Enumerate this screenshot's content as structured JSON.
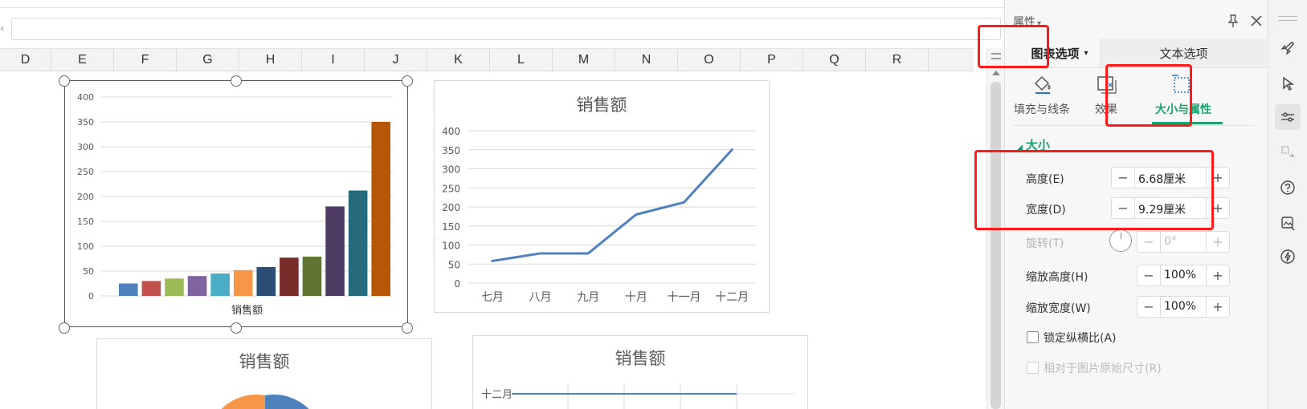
{
  "formula": {
    "close_glyph": "‹"
  },
  "columns": [
    "D",
    "E",
    "F",
    "G",
    "H",
    "I",
    "J",
    "K",
    "L",
    "M",
    "N",
    "O",
    "P",
    "Q",
    "R"
  ],
  "charts": {
    "bar": {
      "type": "bar",
      "xlabel": "销售额",
      "ylim": [
        0,
        400
      ],
      "y_ticks": [
        "0",
        "50",
        "100",
        "150",
        "200",
        "250",
        "300",
        "350",
        "400"
      ],
      "values": [
        25,
        30,
        35,
        40,
        45,
        52,
        58,
        77,
        79,
        180,
        212,
        350
      ],
      "colors": [
        "#4f81bd",
        "#c0504d",
        "#9bbb59",
        "#8064a2",
        "#4bacc6",
        "#f79646",
        "#2c4d75",
        "#772c2a",
        "#5f7530",
        "#4d3b62",
        "#276a7c",
        "#b65708"
      ]
    },
    "line": {
      "type": "line",
      "title": "销售额",
      "ylim": [
        0,
        400
      ],
      "y_ticks": [
        "0",
        "50",
        "100",
        "150",
        "200",
        "250",
        "300",
        "350",
        "400"
      ],
      "categories": [
        "七月",
        "八月",
        "九月",
        "十月",
        "十一月",
        "十二月"
      ],
      "values": [
        58,
        78,
        78,
        180,
        212,
        350
      ],
      "color": "#4f81bd"
    },
    "pie": {
      "title": "销售额"
    },
    "bar2": {
      "title": "销售额",
      "first_label": "十二月"
    }
  },
  "pane": {
    "title": "属性",
    "title_caret": "▾",
    "tabs": {
      "chart_options": "图表选项",
      "chart_caret": "▾",
      "text_options": "文本选项"
    },
    "subtabs": {
      "fill_line": "填充与线条",
      "effects": "效果",
      "size_props": "大小与属性"
    },
    "section": {
      "size": "大小",
      "tri": "◢"
    },
    "height": {
      "label": "高度(E)",
      "value": "6.68厘米"
    },
    "width": {
      "label": "宽度(D)",
      "value": "9.29厘米"
    },
    "rotation": {
      "label": "旋转(T)",
      "value": "0°"
    },
    "scale_height": {
      "label": "缩放高度(H)",
      "value": "100%"
    },
    "scale_width": {
      "label": "缩放宽度(W)",
      "value": "100%"
    },
    "lock_ratio": {
      "label": "锁定纵横比(A)"
    },
    "relative_original": {
      "label": "相对于图片原始尺寸(R)"
    },
    "minus": "−",
    "plus": "+"
  },
  "colors": {
    "accent": "#1aa36f",
    "highlight": "#ff1a1a"
  }
}
